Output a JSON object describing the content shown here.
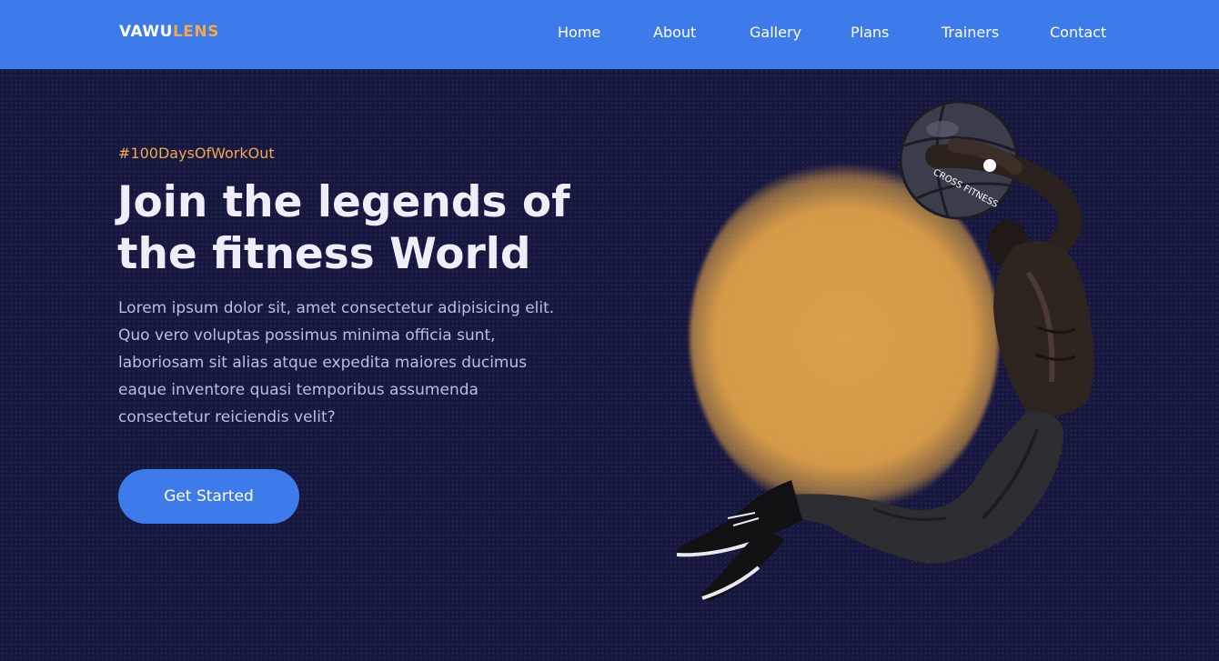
{
  "brand": {
    "part1": "VAWU",
    "part2": "LENS"
  },
  "nav": {
    "items": [
      {
        "label": "Home"
      },
      {
        "label": "About"
      },
      {
        "label": "Gallery"
      },
      {
        "label": "Plans"
      },
      {
        "label": "Trainers"
      },
      {
        "label": "Contact"
      }
    ],
    "active": "Home"
  },
  "hero": {
    "tagline": "#100DaysOfWorkOut",
    "headline_line1": "Join the legends of",
    "headline_line2": "the fitness World",
    "body": "Lorem ipsum dolor sit, amet consectetur adipisicing elit. Quo vero voluptas possimus minima officia sunt, laboriosam sit alias atque expedita maiores ducimus eaque inventore quasi temporibus assumenda consectetur reiciendis velit?",
    "cta_label": "Get Started",
    "ball_text": "CROSS FITNESS"
  },
  "colors": {
    "nav_bg": "#3d7bea",
    "hero_bg": "#16173f",
    "accent": "#f0a94a",
    "glow": "#d9a14b"
  }
}
